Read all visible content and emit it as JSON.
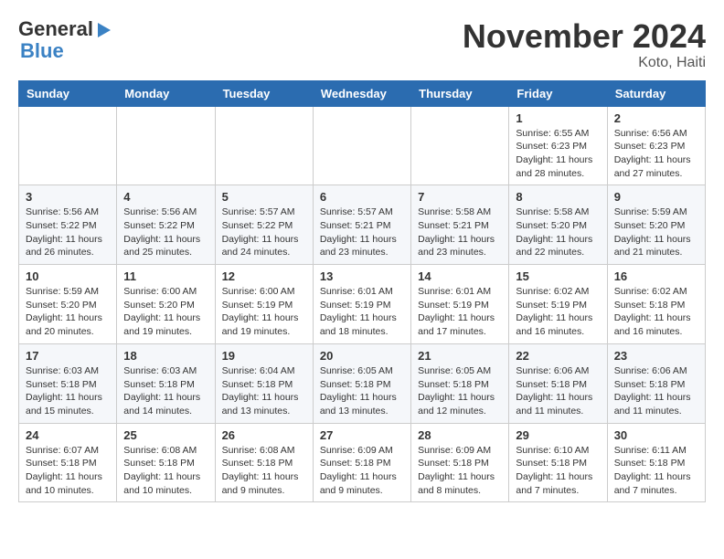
{
  "header": {
    "logo_line1": "General",
    "logo_line2": "Blue",
    "month": "November 2024",
    "location": "Koto, Haiti"
  },
  "weekdays": [
    "Sunday",
    "Monday",
    "Tuesday",
    "Wednesday",
    "Thursday",
    "Friday",
    "Saturday"
  ],
  "weeks": [
    [
      {
        "day": "",
        "info": ""
      },
      {
        "day": "",
        "info": ""
      },
      {
        "day": "",
        "info": ""
      },
      {
        "day": "",
        "info": ""
      },
      {
        "day": "",
        "info": ""
      },
      {
        "day": "1",
        "info": "Sunrise: 6:55 AM\nSunset: 6:23 PM\nDaylight: 11 hours and 28 minutes."
      },
      {
        "day": "2",
        "info": "Sunrise: 6:56 AM\nSunset: 6:23 PM\nDaylight: 11 hours and 27 minutes."
      }
    ],
    [
      {
        "day": "3",
        "info": "Sunrise: 5:56 AM\nSunset: 5:22 PM\nDaylight: 11 hours and 26 minutes."
      },
      {
        "day": "4",
        "info": "Sunrise: 5:56 AM\nSunset: 5:22 PM\nDaylight: 11 hours and 25 minutes."
      },
      {
        "day": "5",
        "info": "Sunrise: 5:57 AM\nSunset: 5:22 PM\nDaylight: 11 hours and 24 minutes."
      },
      {
        "day": "6",
        "info": "Sunrise: 5:57 AM\nSunset: 5:21 PM\nDaylight: 11 hours and 23 minutes."
      },
      {
        "day": "7",
        "info": "Sunrise: 5:58 AM\nSunset: 5:21 PM\nDaylight: 11 hours and 23 minutes."
      },
      {
        "day": "8",
        "info": "Sunrise: 5:58 AM\nSunset: 5:20 PM\nDaylight: 11 hours and 22 minutes."
      },
      {
        "day": "9",
        "info": "Sunrise: 5:59 AM\nSunset: 5:20 PM\nDaylight: 11 hours and 21 minutes."
      }
    ],
    [
      {
        "day": "10",
        "info": "Sunrise: 5:59 AM\nSunset: 5:20 PM\nDaylight: 11 hours and 20 minutes."
      },
      {
        "day": "11",
        "info": "Sunrise: 6:00 AM\nSunset: 5:20 PM\nDaylight: 11 hours and 19 minutes."
      },
      {
        "day": "12",
        "info": "Sunrise: 6:00 AM\nSunset: 5:19 PM\nDaylight: 11 hours and 19 minutes."
      },
      {
        "day": "13",
        "info": "Sunrise: 6:01 AM\nSunset: 5:19 PM\nDaylight: 11 hours and 18 minutes."
      },
      {
        "day": "14",
        "info": "Sunrise: 6:01 AM\nSunset: 5:19 PM\nDaylight: 11 hours and 17 minutes."
      },
      {
        "day": "15",
        "info": "Sunrise: 6:02 AM\nSunset: 5:19 PM\nDaylight: 11 hours and 16 minutes."
      },
      {
        "day": "16",
        "info": "Sunrise: 6:02 AM\nSunset: 5:18 PM\nDaylight: 11 hours and 16 minutes."
      }
    ],
    [
      {
        "day": "17",
        "info": "Sunrise: 6:03 AM\nSunset: 5:18 PM\nDaylight: 11 hours and 15 minutes."
      },
      {
        "day": "18",
        "info": "Sunrise: 6:03 AM\nSunset: 5:18 PM\nDaylight: 11 hours and 14 minutes."
      },
      {
        "day": "19",
        "info": "Sunrise: 6:04 AM\nSunset: 5:18 PM\nDaylight: 11 hours and 13 minutes."
      },
      {
        "day": "20",
        "info": "Sunrise: 6:05 AM\nSunset: 5:18 PM\nDaylight: 11 hours and 13 minutes."
      },
      {
        "day": "21",
        "info": "Sunrise: 6:05 AM\nSunset: 5:18 PM\nDaylight: 11 hours and 12 minutes."
      },
      {
        "day": "22",
        "info": "Sunrise: 6:06 AM\nSunset: 5:18 PM\nDaylight: 11 hours and 11 minutes."
      },
      {
        "day": "23",
        "info": "Sunrise: 6:06 AM\nSunset: 5:18 PM\nDaylight: 11 hours and 11 minutes."
      }
    ],
    [
      {
        "day": "24",
        "info": "Sunrise: 6:07 AM\nSunset: 5:18 PM\nDaylight: 11 hours and 10 minutes."
      },
      {
        "day": "25",
        "info": "Sunrise: 6:08 AM\nSunset: 5:18 PM\nDaylight: 11 hours and 10 minutes."
      },
      {
        "day": "26",
        "info": "Sunrise: 6:08 AM\nSunset: 5:18 PM\nDaylight: 11 hours and 9 minutes."
      },
      {
        "day": "27",
        "info": "Sunrise: 6:09 AM\nSunset: 5:18 PM\nDaylight: 11 hours and 9 minutes."
      },
      {
        "day": "28",
        "info": "Sunrise: 6:09 AM\nSunset: 5:18 PM\nDaylight: 11 hours and 8 minutes."
      },
      {
        "day": "29",
        "info": "Sunrise: 6:10 AM\nSunset: 5:18 PM\nDaylight: 11 hours and 7 minutes."
      },
      {
        "day": "30",
        "info": "Sunrise: 6:11 AM\nSunset: 5:18 PM\nDaylight: 11 hours and 7 minutes."
      }
    ]
  ]
}
